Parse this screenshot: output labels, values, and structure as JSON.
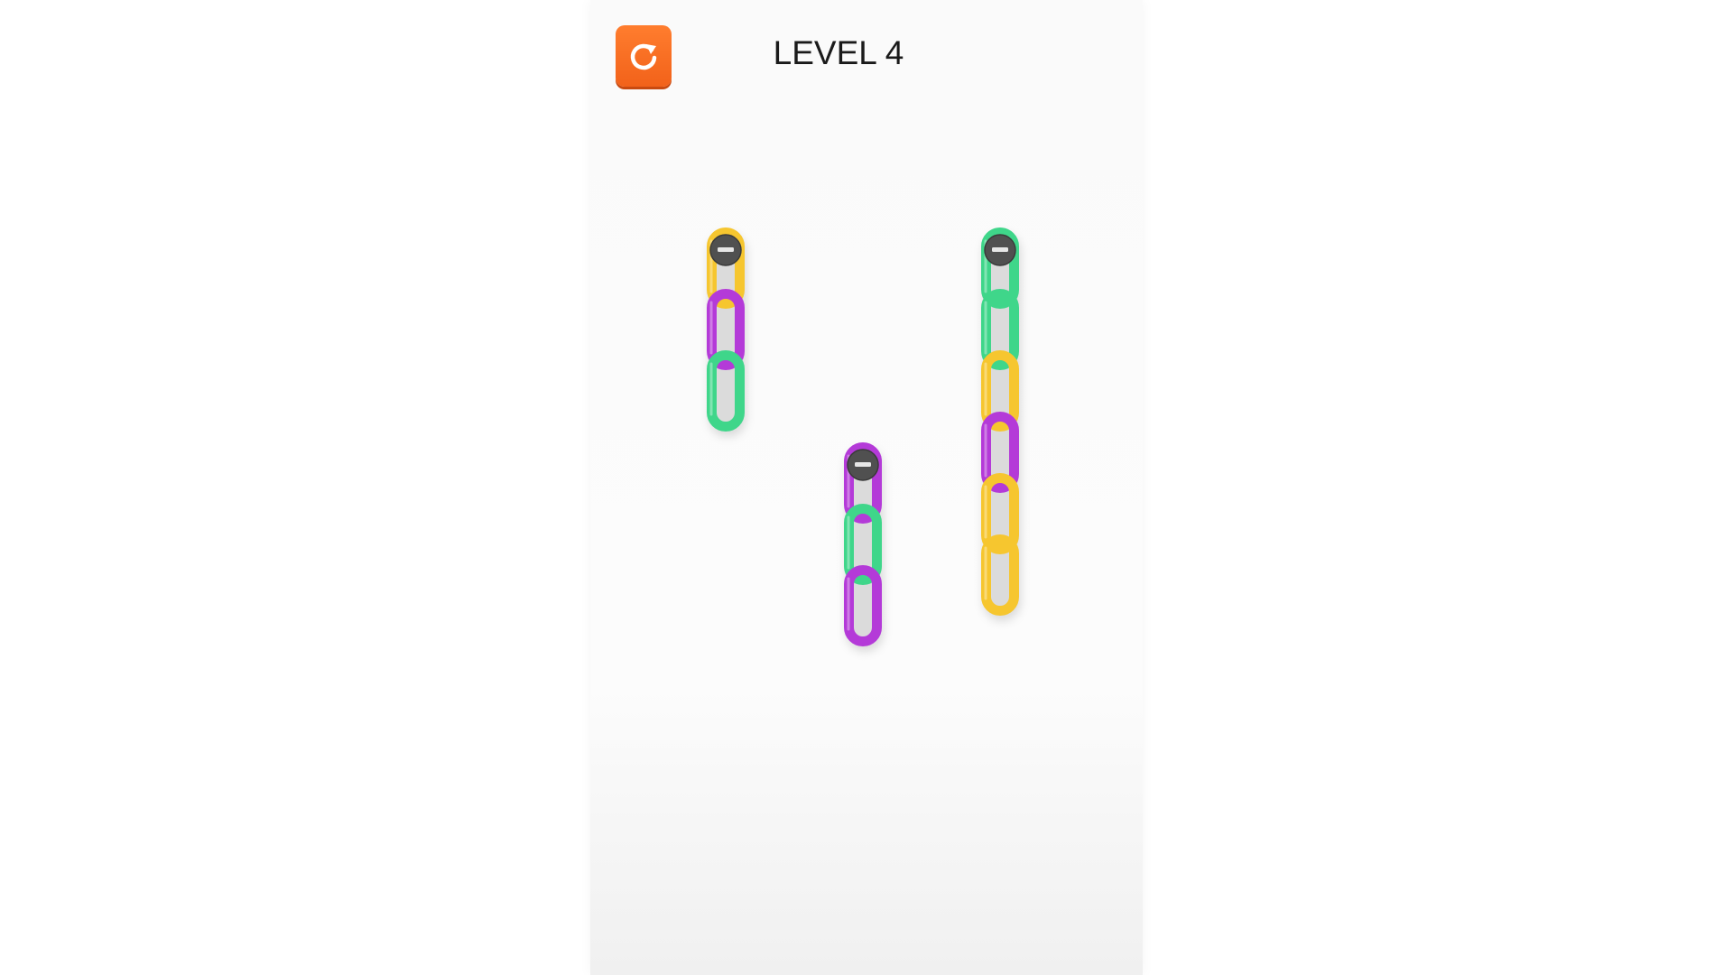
{
  "header": {
    "level_label": "LEVEL 4",
    "restart_icon": "restart-icon",
    "restart_color": "#f26a1f"
  },
  "colors": {
    "yellow": "#f6c62f",
    "purple": "#b43ad8",
    "green": "#3fd68a",
    "peg": "#505050"
  },
  "board": {
    "chains": [
      {
        "id": "left",
        "links": [
          "yellow",
          "purple",
          "green"
        ]
      },
      {
        "id": "middle",
        "links": [
          "purple",
          "green",
          "purple"
        ]
      },
      {
        "id": "right",
        "links": [
          "green",
          "green",
          "yellow",
          "purple",
          "yellow",
          "yellow"
        ]
      }
    ]
  }
}
